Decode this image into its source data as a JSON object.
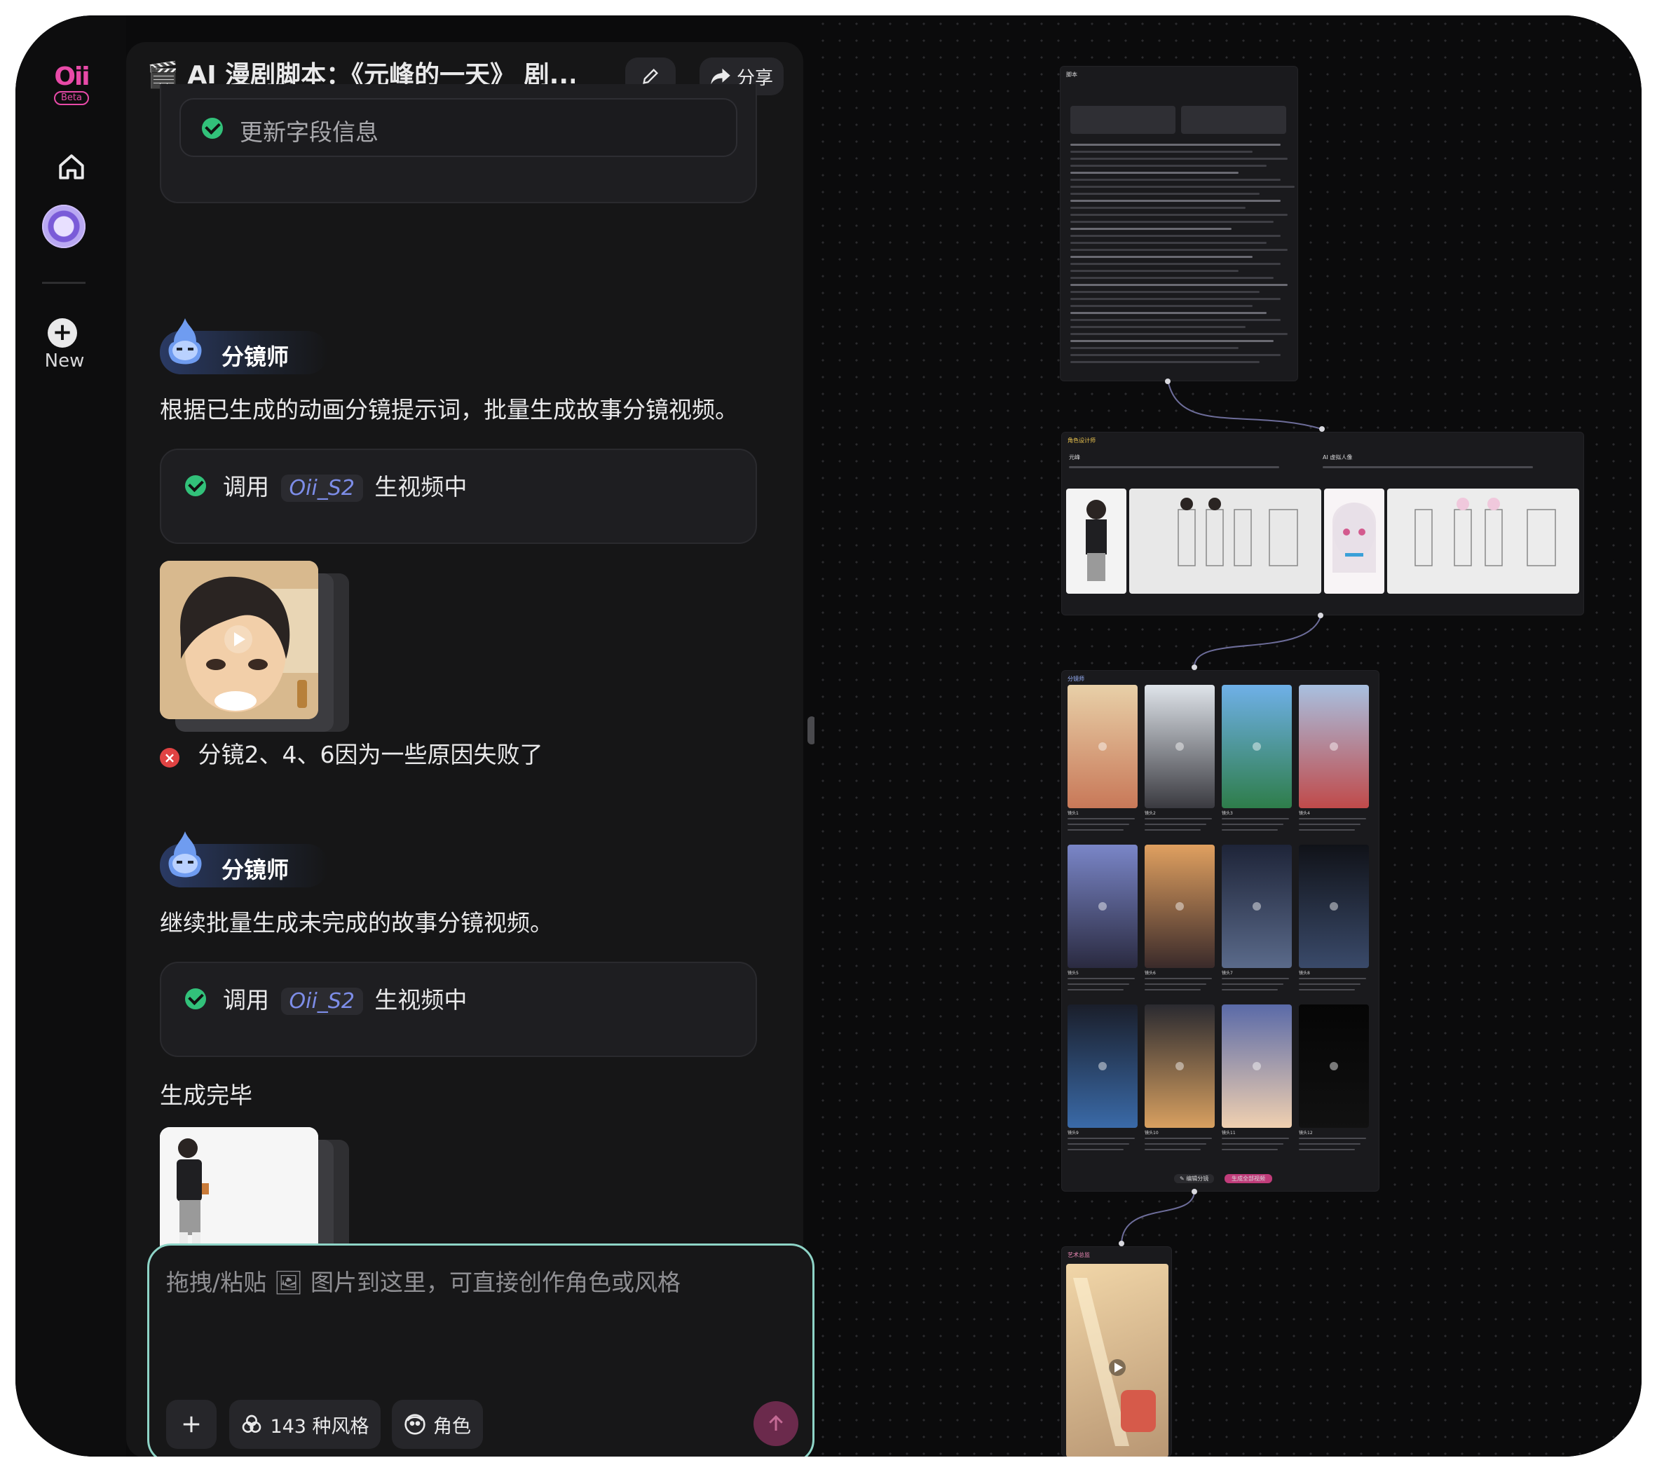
{
  "app": {
    "logo": "Oii",
    "badge": "Beta",
    "new_label": "New"
  },
  "header": {
    "title": "🎬 AI 漫剧脚本：《元峰的一天》 剧...",
    "share_label": "分享"
  },
  "messages": {
    "update_fields": "更新字段信息",
    "agent1_name": "分镜师",
    "agent1_text": "根据已生成的动画分镜提示词，批量生成故事分镜视频。",
    "call1_prefix": "调用",
    "call1_model": "Oii_S2",
    "call1_suffix": "生视频中",
    "error_text": "分镜2、4、6因为一些原因失败了",
    "agent2_name": "分镜师",
    "agent2_text": "继续批量生成未完成的故事分镜视频。",
    "call2_prefix": "调用",
    "call2_model": "Oii_S2",
    "call2_suffix": "生视频中",
    "done_text": "生成完毕"
  },
  "composer": {
    "placeholder": "拖拽/粘贴 🖼 图片到这里，可直接创作角色或风格",
    "style_button": "143 种风格",
    "role_button": "角色"
  },
  "canvas": {
    "script_node_title": "脚本",
    "character_node_title": "角色设计师",
    "character_a": "元峰",
    "character_b": "AI 虚拟人像",
    "storyboard_node_title": "分镜师",
    "frame_labels": [
      "镜头1",
      "镜头2",
      "镜头3",
      "镜头4",
      "镜头5",
      "镜头6",
      "镜头7",
      "镜头8",
      "镜头9",
      "镜头10",
      "镜头11",
      "镜头12"
    ],
    "storyboard_actions": [
      "✎ 编辑分镜",
      "生成全部视频"
    ],
    "final_node_title": "艺术总监"
  },
  "colors": {
    "accent_pink": "#e84aa8",
    "success_green": "#32c17a",
    "error_red": "#e04343",
    "model_blue": "#7d8de8",
    "input_border": "#8ed4c7"
  },
  "icons": [
    "home-icon",
    "orb-icon",
    "plus-icon",
    "edit-icon",
    "share-icon",
    "check-icon",
    "error-icon",
    "agent-flame-icon",
    "style-icon",
    "role-icon",
    "send-icon",
    "play-icon"
  ]
}
